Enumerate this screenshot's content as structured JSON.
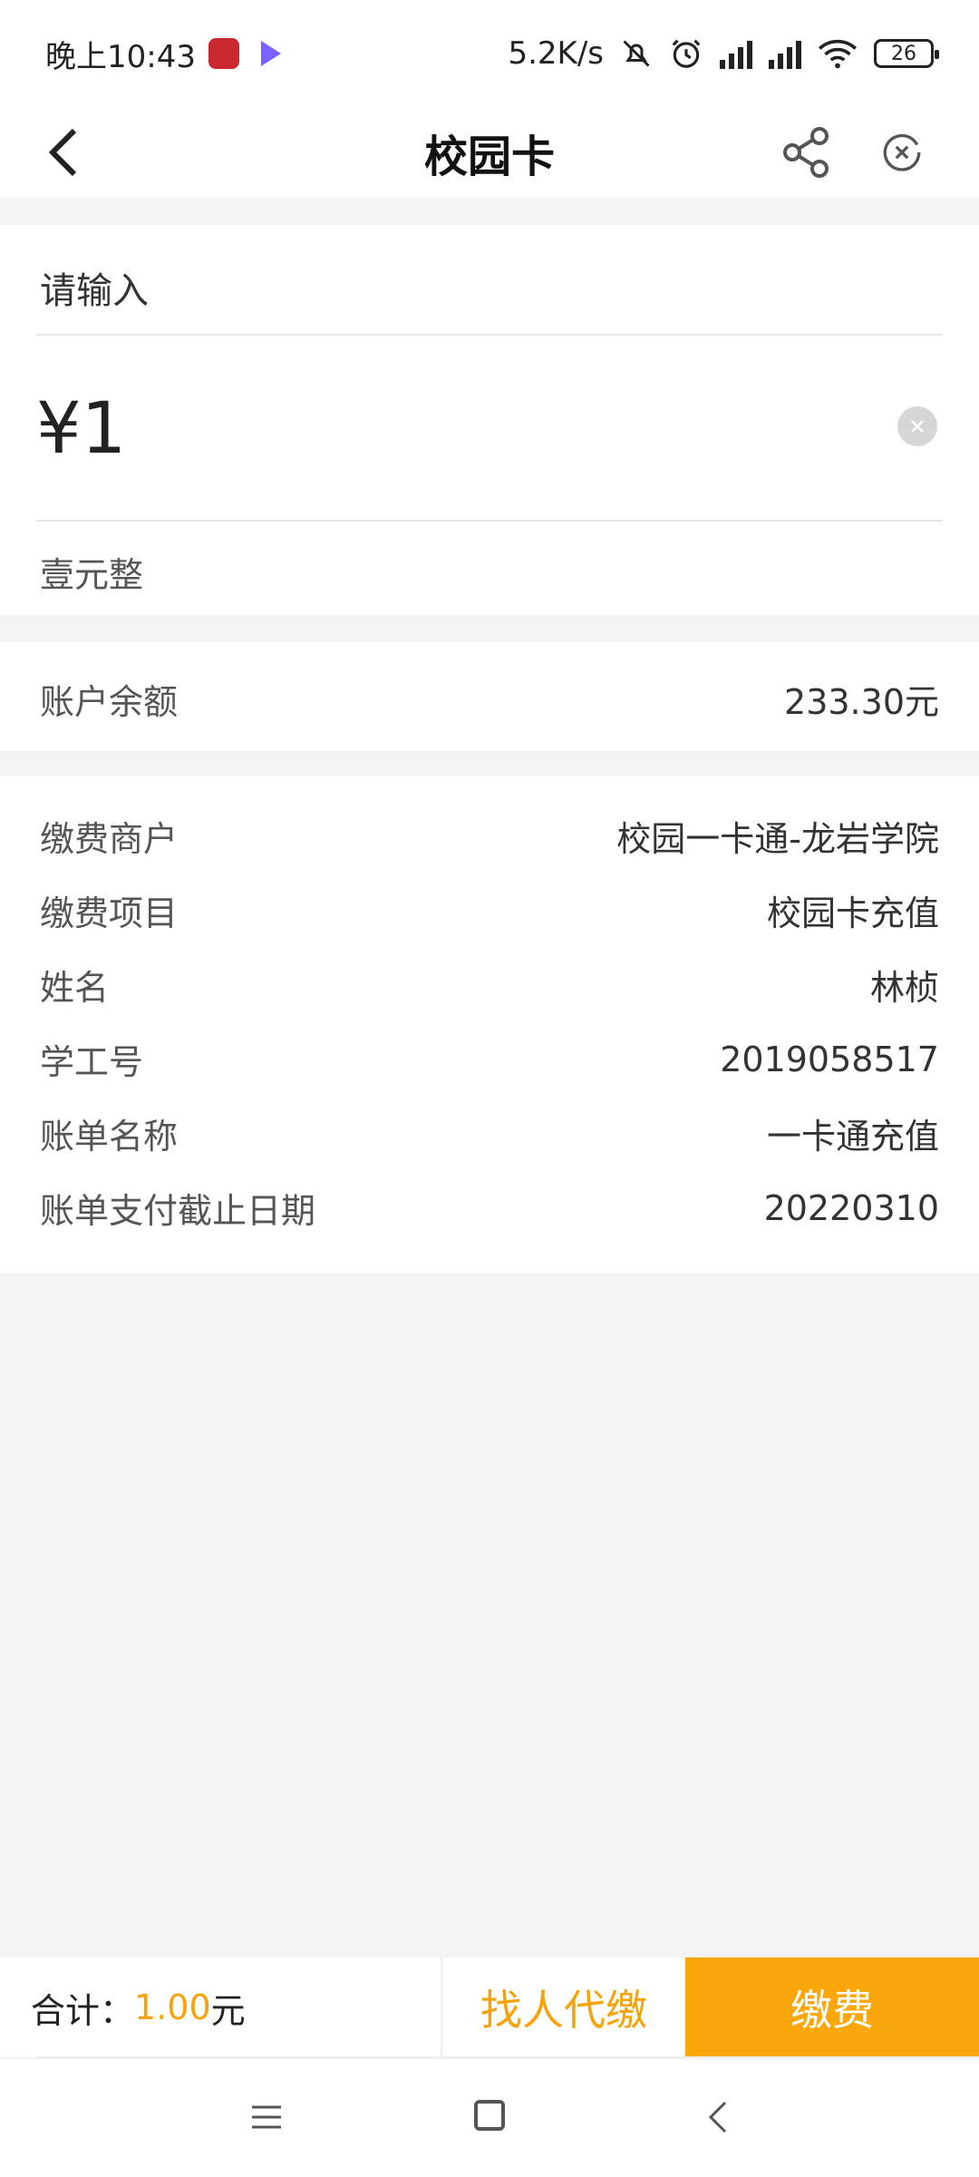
{
  "status_bar": {
    "time": "晚上10:43",
    "network_speed": "5.2K/s",
    "battery": "26",
    "icons": [
      "app-badge-icon",
      "video-app-icon",
      "mute-bell-icon",
      "alarm-icon",
      "hd-signal-icon",
      "hd-signal-icon",
      "wifi-icon",
      "battery-icon"
    ]
  },
  "header": {
    "title": "校园卡",
    "back_icon": "back-arrow-icon",
    "share_icon": "share-icon",
    "close_icon": "close-circle-icon"
  },
  "amount": {
    "input_label": "请输入",
    "value": "¥1",
    "words": "壹元整"
  },
  "balance": {
    "label": "账户余额",
    "value": "233.30元"
  },
  "details": [
    {
      "label": "缴费商户",
      "value": "校园一卡通-龙岩学院"
    },
    {
      "label": "缴费项目",
      "value": "校园卡充值"
    },
    {
      "label": "姓名",
      "value": "林桢"
    },
    {
      "label": "学工号",
      "value": "2019058517"
    },
    {
      "label": "账单名称",
      "value": "一卡通充值"
    },
    {
      "label": "账单支付截止日期",
      "value": "20220310"
    }
  ],
  "bottom_bar": {
    "total_label": "合计：",
    "total_amount": "1.00",
    "total_unit": "元",
    "proxy_pay_label": "找人代缴",
    "pay_label": "缴费"
  },
  "colors": {
    "accent": "#f9a70b",
    "accent_text": "#f5a308",
    "background": "#f3f3f3"
  }
}
